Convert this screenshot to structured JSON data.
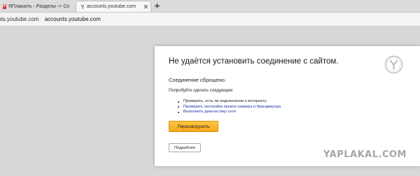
{
  "browser": {
    "tabs": [
      {
        "title": "ЯПлакалъ - Разделы -> Со",
        "favicon": "yaplakal-favicon",
        "active": false
      },
      {
        "title": "accounts.youtube.com",
        "favicon": "yandex-page-icon",
        "active": true
      }
    ],
    "new_tab_icon": "plus-icon",
    "close_icon": "close-icon",
    "address": {
      "host_text": "nts.youtube.com",
      "url_text": "accounts.youtube.com"
    }
  },
  "error_page": {
    "title": "Не удаётся установить соединение с сайтом.",
    "subtitle": "Соединение сброшено.",
    "try_text": "Попробуйте сделать следующее:",
    "suggestions": [
      {
        "text": "Проверить, есть ли подключение к интернету.",
        "link": false
      },
      {
        "text": "Проверить настройки прокси-сервера и брандмауэра",
        "link": true
      },
      {
        "text": "Выполнить диагностику сети",
        "link": true
      }
    ],
    "reload_label": "Перезагрузить",
    "details_label": "Подробнее",
    "logo_icon": "yandex-browser-logo-icon",
    "accent_color": "#f9b52b"
  },
  "watermark": "YAPLAKAL.COM"
}
